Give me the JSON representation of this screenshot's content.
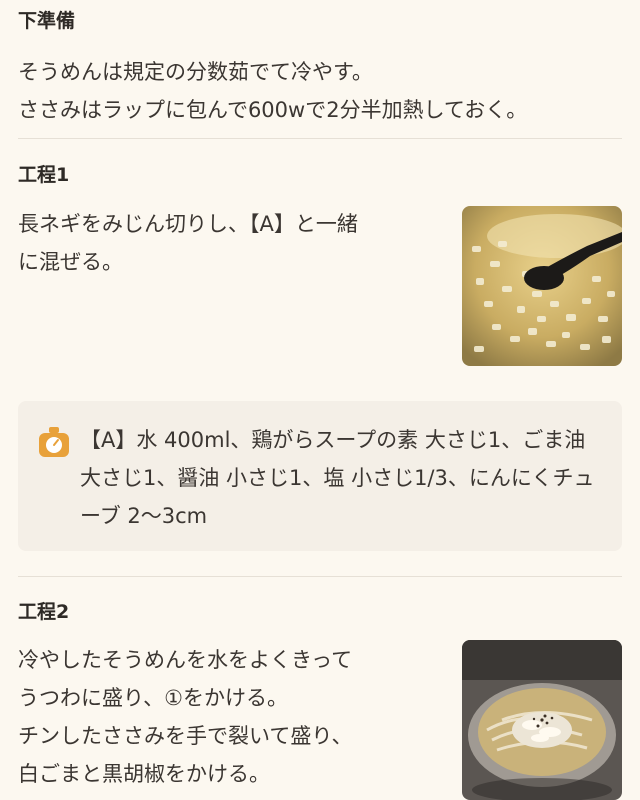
{
  "prep": {
    "title": "下準備",
    "line1": "そうめんは規定の分数茹でて冷やす。",
    "line2": "ささみはラップに包んで600wで2分半加熱しておく。"
  },
  "step1": {
    "title": "工程1",
    "line1": "長ネギをみじん切りし、【A】と一緒",
    "line2": "に混ぜる。"
  },
  "note": {
    "icon": "scale-icon",
    "text": "【A】水 400ml、鶏がらスープの素 大さじ1、ごま油 大さじ1、醤油 小さじ1、塩 小さじ1/3、にんにくチューブ 2〜3cm"
  },
  "step2": {
    "title": "工程2",
    "line1": "冷やしたそうめんを水をよくきって",
    "line2": "うつわに盛り、①をかける。",
    "line3": "チンしたささみを手で裂いて盛り、",
    "line4": "白ごまと黒胡椒をかける。"
  },
  "colors": {
    "background": "#fcf8f0",
    "note_bg": "#f4efe7",
    "icon_orange": "#e8a13a"
  }
}
